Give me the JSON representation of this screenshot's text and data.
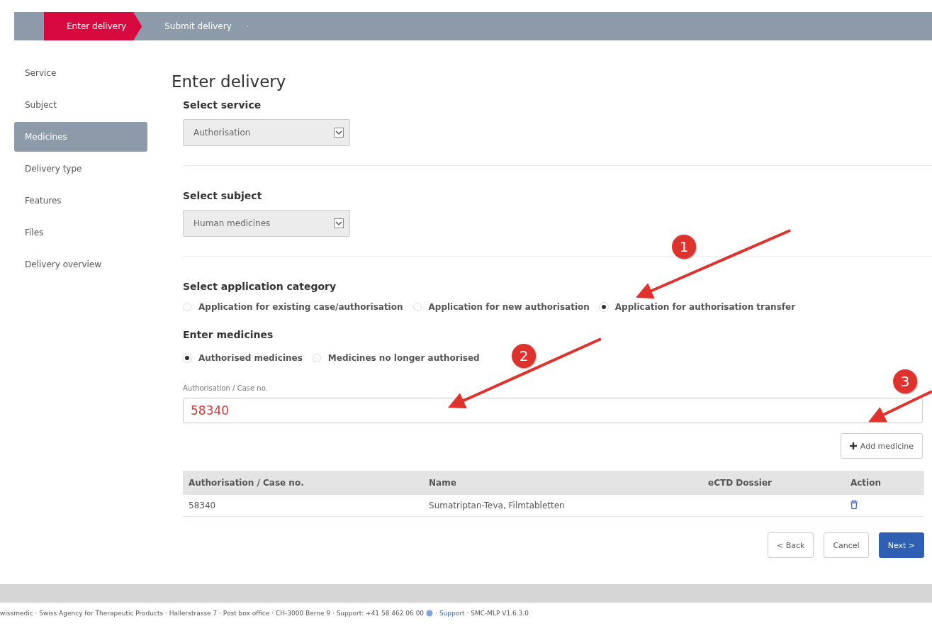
{
  "steps": [
    {
      "label": "Enter delivery",
      "selected": true
    },
    {
      "label": "Submit delivery",
      "selected": false
    }
  ],
  "sidebar": {
    "items": [
      {
        "label": "Service",
        "selected": false
      },
      {
        "label": "Subject",
        "selected": false
      },
      {
        "label": "Medicines",
        "selected": true
      },
      {
        "label": "Delivery type",
        "selected": false
      },
      {
        "label": "Features",
        "selected": false
      },
      {
        "label": "Files",
        "selected": false
      },
      {
        "label": "Delivery overview",
        "selected": false
      }
    ]
  },
  "title": "Enter delivery",
  "service": {
    "label": "Select service",
    "value": "Authorisation"
  },
  "subject": {
    "label": "Select subject",
    "value": "Human medicines"
  },
  "category": {
    "label": "Select application category",
    "options": [
      {
        "label": "Application for existing case/authorisation",
        "selected": false
      },
      {
        "label": "Application for new authorisation",
        "selected": false
      },
      {
        "label": "Application for authorisation transfer",
        "selected": true
      }
    ]
  },
  "medicines": {
    "label": "Enter medicines",
    "options": [
      {
        "label": "Authorised medicines",
        "selected": true
      },
      {
        "label": "Medicines no longer authorised",
        "selected": false
      }
    ],
    "field_label": "Authorisation / Case no.",
    "value": "58340",
    "add_button": "Add medicine"
  },
  "table": {
    "columns": [
      "Authorisation / Case no.",
      "Name",
      "eCTD Dossier",
      "Action"
    ],
    "rows": [
      {
        "case_no": "58340",
        "name": "Sumatriptan-Teva, Filmtabletten",
        "dossier": ""
      }
    ]
  },
  "buttons": {
    "back": "< Back",
    "cancel": "Cancel",
    "next": "Next >"
  },
  "annotations": [
    "1",
    "2",
    "3"
  ],
  "footer": {
    "text": "wissmedic · Swiss Agency for Therapeutic Products · Hallerstrasse 7 · Post box office · CH-3000 Berne 9 · Support: +41 58 462 06 00",
    "link": "Support",
    "version": "· SMC-MLP V1.6.3.0",
    "separator": "·"
  }
}
